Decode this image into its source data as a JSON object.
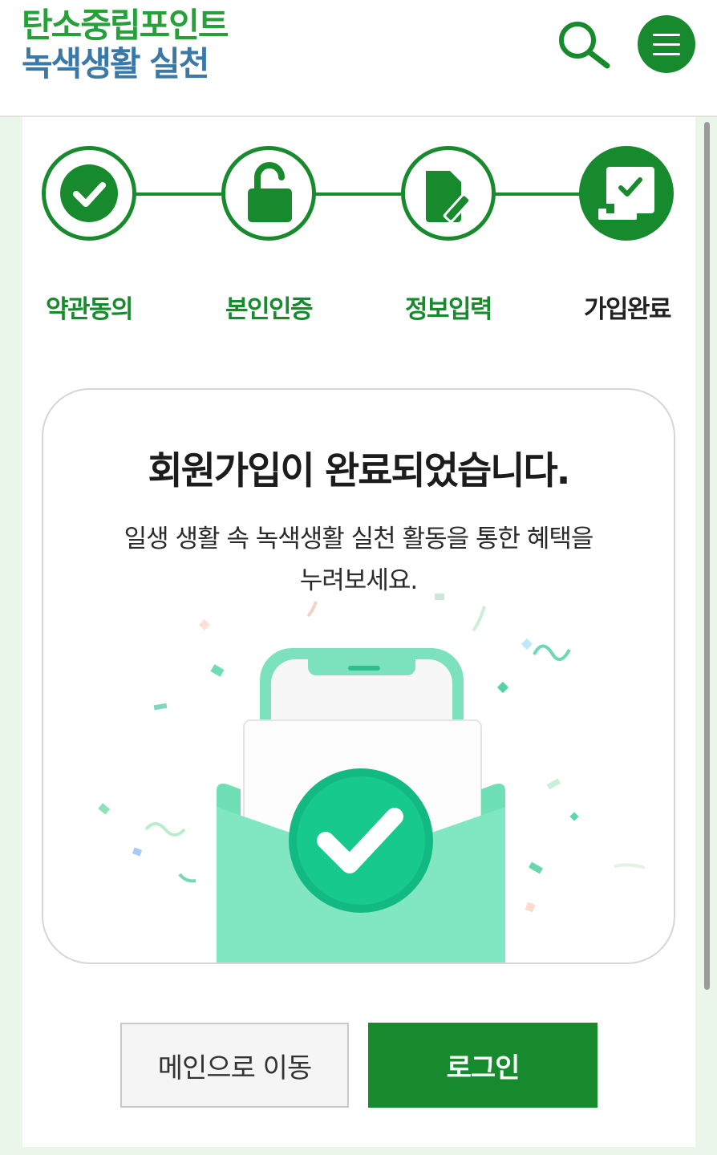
{
  "header": {
    "logo_line1": "탄소중립포인트",
    "logo_line2": "녹색생활 실천",
    "search_icon": "search-icon",
    "menu_icon": "hamburger-menu-icon"
  },
  "steps": [
    {
      "label": "약관동의",
      "icon": "check-circle-icon",
      "state": "done"
    },
    {
      "label": "본인인증",
      "icon": "unlock-icon",
      "state": "done"
    },
    {
      "label": "정보입력",
      "icon": "edit-document-icon",
      "state": "done"
    },
    {
      "label": "가입완료",
      "icon": "certificate-icon",
      "state": "active"
    }
  ],
  "card": {
    "title": "회원가입이 완료되었습니다.",
    "desc_line1": "일생 생활 속 녹색생활 실천 활동을 통한 혜택을",
    "desc_line2": "누려보세요."
  },
  "buttons": {
    "main": "메인으로 이동",
    "login": "로그인"
  },
  "colors": {
    "brand_green": "#178a2e",
    "logo_green": "#28a03a",
    "logo_blue": "#3a78a8",
    "illustration_mint": "#5ad8a6",
    "page_bg": "#ebf6ea"
  }
}
